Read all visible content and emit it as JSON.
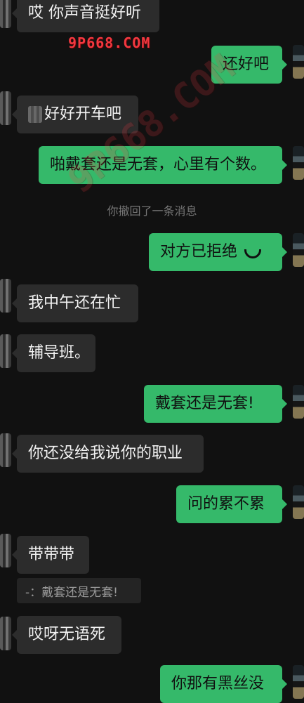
{
  "messages": {
    "m1": "哎 你声音挺好听",
    "m2": "还好吧",
    "m3": "好好开车吧",
    "m4": "啪戴套还是无套，心里有个数。",
    "system": "你撤回了一条消息",
    "m5": "对方已拒绝",
    "m6": "我中午还在忙",
    "m7": "辅导班。",
    "m8": "戴套还是无套!",
    "m9": "你还没给我说你的职业",
    "m10": "问的累不累",
    "m11": "带带带",
    "quote": "-：戴套还是无套!",
    "m12": "哎呀无语死",
    "m13": "你那有黑丝没"
  },
  "watermarks": {
    "top": "9P668.COM",
    "diagonal": "9P668.COM"
  },
  "icons": {
    "call": "call-rejected-icon",
    "blur": "blurred-text"
  },
  "colors": {
    "background": "#111111",
    "incoming_bubble": "#2c2c2c",
    "outgoing_bubble": "#35b96a",
    "watermark": "#ff3b43"
  }
}
